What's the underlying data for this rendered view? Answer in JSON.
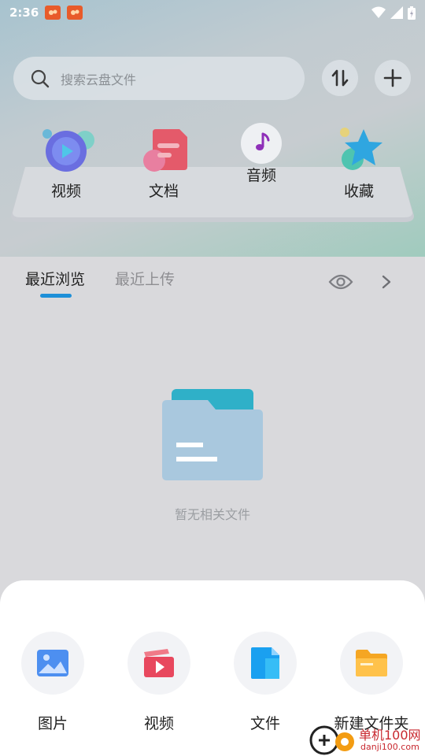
{
  "status_bar": {
    "time": "2:36"
  },
  "search": {
    "placeholder": "搜索云盘文件"
  },
  "header_icons": {
    "sort": "sort-arrows-icon",
    "add": "plus-icon"
  },
  "categories": [
    {
      "label": "视频",
      "icon": "video-icon"
    },
    {
      "label": "文档",
      "icon": "document-icon"
    },
    {
      "label": "音频",
      "icon": "music-note-icon"
    },
    {
      "label": "收藏",
      "icon": "star-icon"
    }
  ],
  "tabs": {
    "active": "最近浏览",
    "inactive": "最近上传"
  },
  "empty_state": {
    "message": "暂无相关文件"
  },
  "sheet_actions": [
    {
      "label": "图片",
      "icon": "image-icon"
    },
    {
      "label": "视频",
      "icon": "video-clip-icon"
    },
    {
      "label": "文件",
      "icon": "file-icon"
    },
    {
      "label": "新建文件夹",
      "icon": "folder-icon"
    }
  ],
  "watermark": {
    "brand": "单机100网",
    "url": "danji100.com"
  },
  "colors": {
    "accent": "#1d8fd8",
    "sheet_bg": "#ffffff",
    "page_bg": "#d9d9dc"
  }
}
